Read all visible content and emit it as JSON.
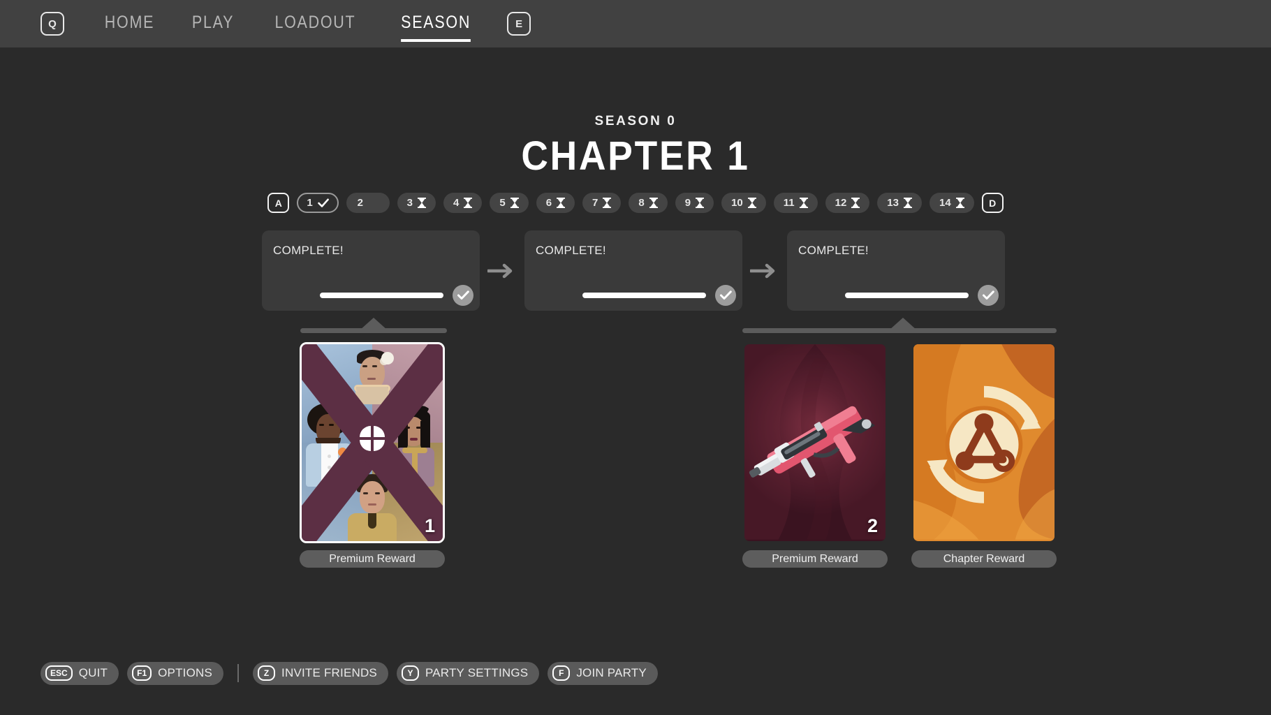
{
  "nav": {
    "left_key": "Q",
    "right_key": "E",
    "items": [
      {
        "label": "HOME",
        "active": false
      },
      {
        "label": "PLAY",
        "active": false
      },
      {
        "label": "LOADOUT",
        "active": false
      },
      {
        "label": "SEASON",
        "active": true
      }
    ]
  },
  "header": {
    "season_label": "SEASON 0",
    "chapter_title": "CHAPTER 1"
  },
  "chapter_selector": {
    "prev_key": "A",
    "next_key": "D",
    "chapters": [
      {
        "number": "1",
        "state": "current",
        "icon": "check-icon"
      },
      {
        "number": "2",
        "state": "unlocked",
        "icon": "none"
      },
      {
        "number": "3",
        "state": "locked",
        "icon": "hourglass-icon"
      },
      {
        "number": "4",
        "state": "locked",
        "icon": "hourglass-icon"
      },
      {
        "number": "5",
        "state": "locked",
        "icon": "hourglass-icon"
      },
      {
        "number": "6",
        "state": "locked",
        "icon": "hourglass-icon"
      },
      {
        "number": "7",
        "state": "locked",
        "icon": "hourglass-icon"
      },
      {
        "number": "8",
        "state": "locked",
        "icon": "hourglass-icon"
      },
      {
        "number": "9",
        "state": "locked",
        "icon": "hourglass-icon"
      },
      {
        "number": "10",
        "state": "locked",
        "icon": "hourglass-icon"
      },
      {
        "number": "11",
        "state": "locked",
        "icon": "hourglass-icon"
      },
      {
        "number": "12",
        "state": "locked",
        "icon": "hourglass-icon"
      },
      {
        "number": "13",
        "state": "locked",
        "icon": "hourglass-icon"
      },
      {
        "number": "14",
        "state": "locked",
        "icon": "hourglass-icon"
      }
    ]
  },
  "quests": [
    {
      "status": "COMPLETE!",
      "progress_percent": 100
    },
    {
      "status": "COMPLETE!",
      "progress_percent": 100
    },
    {
      "status": "COMPLETE!",
      "progress_percent": 100
    }
  ],
  "quest_connector_icon": "arrow-right-icon",
  "rewards": [
    {
      "id": "character-bundle",
      "label": "Premium Reward",
      "quantity": "1",
      "selected": true,
      "art": "character-bundle-art",
      "accent": "#5c2f44"
    },
    {
      "id": "weapon-skin",
      "label": "Premium Reward",
      "quantity": "2",
      "selected": false,
      "art": "weapon-art",
      "accent": "#e2566f"
    },
    {
      "id": "chapter-token",
      "label": "Chapter Reward",
      "quantity": "",
      "selected": false,
      "art": "chapter-token-art",
      "accent": "#e08a2e"
    }
  ],
  "footer": {
    "hints": [
      {
        "key": "ESC",
        "label": "QUIT"
      },
      {
        "key": "F1",
        "label": "OPTIONS"
      },
      {
        "key": "Z",
        "label": "INVITE FRIENDS"
      },
      {
        "key": "Y",
        "label": "PARTY SETTINGS"
      },
      {
        "key": "F",
        "label": "JOIN PARTY"
      }
    ]
  },
  "colors": {
    "background": "#2a2a2a",
    "navbar": "#414141",
    "card": "#3a3a3a",
    "pill": "#5d5d5d",
    "accent_white": "#ffffff"
  }
}
